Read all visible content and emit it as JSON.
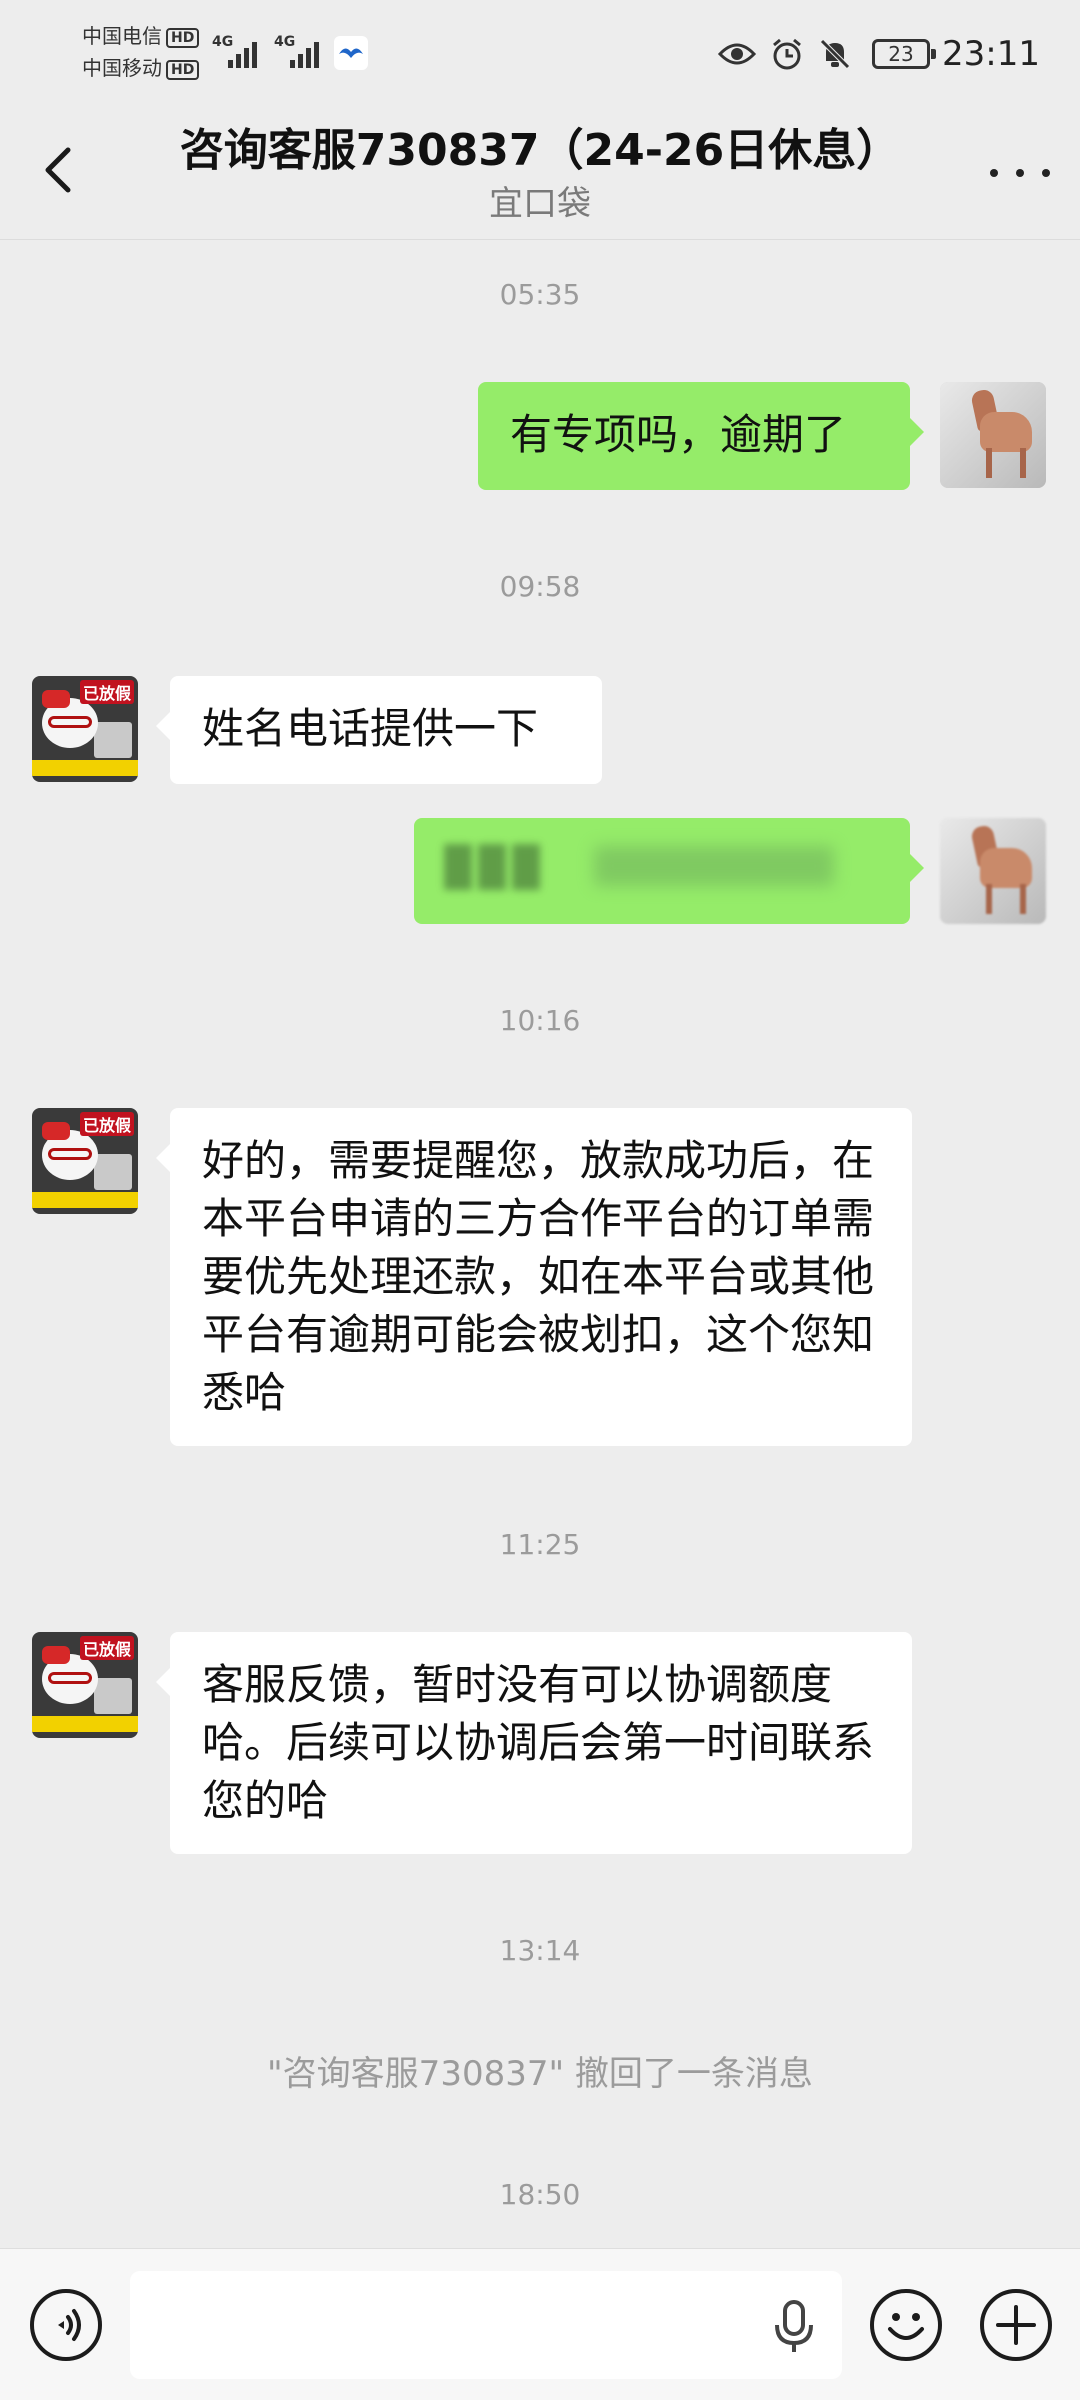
{
  "status_bar": {
    "carrier_1": "中国电信",
    "carrier_2": "中国移动",
    "hd_1": "HD",
    "hd_2": "HD",
    "network_1": "4G",
    "network_2": "4G",
    "battery": "23",
    "time": "23:11"
  },
  "header": {
    "title": "咨询客服730837（24-26日休息）",
    "subtitle": "宜口袋"
  },
  "messages": {
    "ts_1": "05:35",
    "out_1": "有专项吗，逾期了",
    "ts_2": "09:58",
    "in_1": "姓名电话提供一下",
    "ts_3": "10:16",
    "in_2": "好的，需要提醒您，放款成功后，在本平台申请的三方合作平台的订单需要优先处理还款，如在本平台或其他平台有逾期可能会被划扣，这个您知悉哈",
    "ts_4": "11:25",
    "in_3": "客服反馈，暂时没有可以协调额度哈。后续可以协调后会第一时间联系您的哈",
    "ts_5": "13:14",
    "recall": "\"咨询客服730837\" 撤回了一条消息",
    "ts_6": "18:50"
  },
  "avatar_labels": {
    "agent_tag": "已放假"
  },
  "icons": {
    "back": "chevron-left-icon",
    "more": "more-dots-icon",
    "voice": "voice-icon",
    "mic": "microphone-icon",
    "emoji": "emoji-icon",
    "plus": "plus-icon"
  },
  "colors": {
    "background": "#ededed",
    "outgoing_bubble": "#95ec69",
    "incoming_bubble": "#ffffff",
    "timestamp": "#9b9b9b"
  }
}
